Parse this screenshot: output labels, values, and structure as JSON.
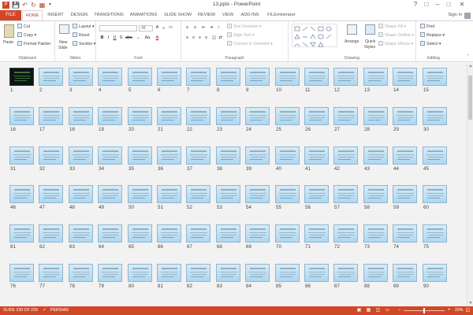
{
  "window": {
    "title": "13.pptx - PowerPoint",
    "qat_icons": [
      "powerpoint-logo-icon",
      "save-icon",
      "undo-icon",
      "redo-icon",
      "start-slideshow-icon",
      "customize-qat-icon"
    ],
    "controls": {
      "help": "?",
      "restore_ribbon": "□",
      "minimize": "–",
      "maximize": "□",
      "close": "✕"
    }
  },
  "ribbon_tabs": {
    "file": "FILE",
    "tabs": [
      "HOME",
      "INSERT",
      "DESIGN",
      "TRANSITIONS",
      "ANIMATIONS",
      "SLIDE SHOW",
      "REVIEW",
      "VIEW",
      "ADD-INS",
      "FILEminimizer"
    ],
    "active": "HOME",
    "signin": "Sign in"
  },
  "ribbon": {
    "clipboard": {
      "label": "Clipboard",
      "paste": "Paste",
      "cut": "Cut",
      "copy": "Copy",
      "format_painter": "Format Painter"
    },
    "slides": {
      "label": "Slides",
      "new_slide": "New",
      "new_slide_2": "Slide",
      "layout": "Layout",
      "reset": "Reset",
      "section": "Section"
    },
    "font": {
      "label": "Font",
      "size": "48",
      "bold": "B",
      "italic": "I",
      "underline": "U",
      "shadow": "S",
      "strike": "abc",
      "aa": "Aa",
      "font_color": "A"
    },
    "paragraph": {
      "label": "Paragraph",
      "text_direction": "Text Direction",
      "align_text": "Align Text",
      "convert_smartart": "Convert to SmartArt"
    },
    "drawing": {
      "label": "Drawing",
      "arrange": "Arrange",
      "quick_styles": "Quick",
      "quick_styles_2": "Styles",
      "shape_fill": "Shape Fill",
      "shape_outline": "Shape Outline",
      "shape_effects": "Shape Effects"
    },
    "editing": {
      "label": "Editing",
      "find": "Find",
      "replace": "Replace",
      "select": "Select"
    }
  },
  "slides": {
    "columns": 15,
    "visible_rows": 7,
    "numbers": [
      1,
      2,
      3,
      4,
      5,
      6,
      7,
      8,
      9,
      10,
      11,
      12,
      13,
      14,
      15,
      16,
      17,
      18,
      19,
      20,
      21,
      22,
      23,
      24,
      25,
      26,
      27,
      28,
      29,
      30,
      31,
      32,
      33,
      34,
      35,
      36,
      37,
      38,
      39,
      40,
      41,
      42,
      43,
      44,
      45,
      46,
      47,
      48,
      49,
      50,
      51,
      52,
      53,
      54,
      55,
      56,
      57,
      58,
      59,
      60,
      61,
      62,
      63,
      64,
      65,
      66,
      67,
      68,
      69,
      70,
      71,
      72,
      73,
      74,
      75,
      76,
      77,
      78,
      79,
      80,
      81,
      82,
      83,
      84,
      85,
      86,
      87,
      88,
      89,
      90
    ],
    "dark_slides": [
      1
    ]
  },
  "status": {
    "slide_info": "SLIDE 239 OF 239",
    "language": "PERSIAN",
    "zoom": "20%",
    "zoom_minus": "−",
    "zoom_plus": "+",
    "zoom_level": 0.2
  },
  "colors": {
    "accent": "#d24726",
    "slide_bg": "#bfe0f4"
  }
}
